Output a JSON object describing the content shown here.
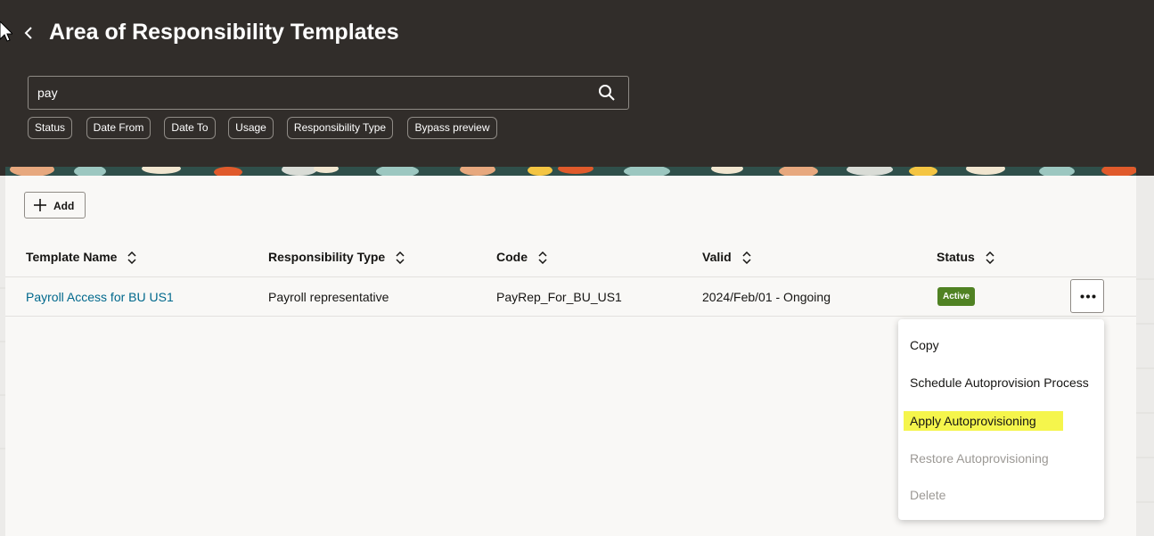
{
  "page": {
    "title": "Area of Responsibility Templates"
  },
  "search": {
    "value": "pay"
  },
  "filters": [
    "Status",
    "Date From",
    "Date To",
    "Usage",
    "Responsibility Type",
    "Bypass preview"
  ],
  "toolbar": {
    "add_label": "Add"
  },
  "table": {
    "columns": [
      "Template Name",
      "Responsibility Type",
      "Code",
      "Valid",
      "Status"
    ],
    "rows": [
      {
        "template_name": "Payroll Access for BU US1",
        "responsibility_type": "Payroll representative",
        "code": "PayRep_For_BU_US1",
        "valid": "2024/Feb/01 - Ongoing",
        "status": "Active"
      }
    ]
  },
  "menu": {
    "items": [
      {
        "label": "Copy",
        "enabled": true
      },
      {
        "label": "Schedule Autoprovision Process",
        "enabled": true
      },
      {
        "label": "Apply Autoprovisioning",
        "enabled": true,
        "highlighted": true
      },
      {
        "label": "Restore Autoprovisioning",
        "enabled": false
      },
      {
        "label": "Delete",
        "enabled": false
      }
    ]
  },
  "colors": {
    "header_bg": "#312d2a",
    "link": "#00688c",
    "active_badge": "#508223",
    "highlight": "#f5f54c"
  },
  "icons": [
    "back-icon",
    "search-icon",
    "plus-icon",
    "sort-icon",
    "more-icon",
    "cursor-icon"
  ]
}
